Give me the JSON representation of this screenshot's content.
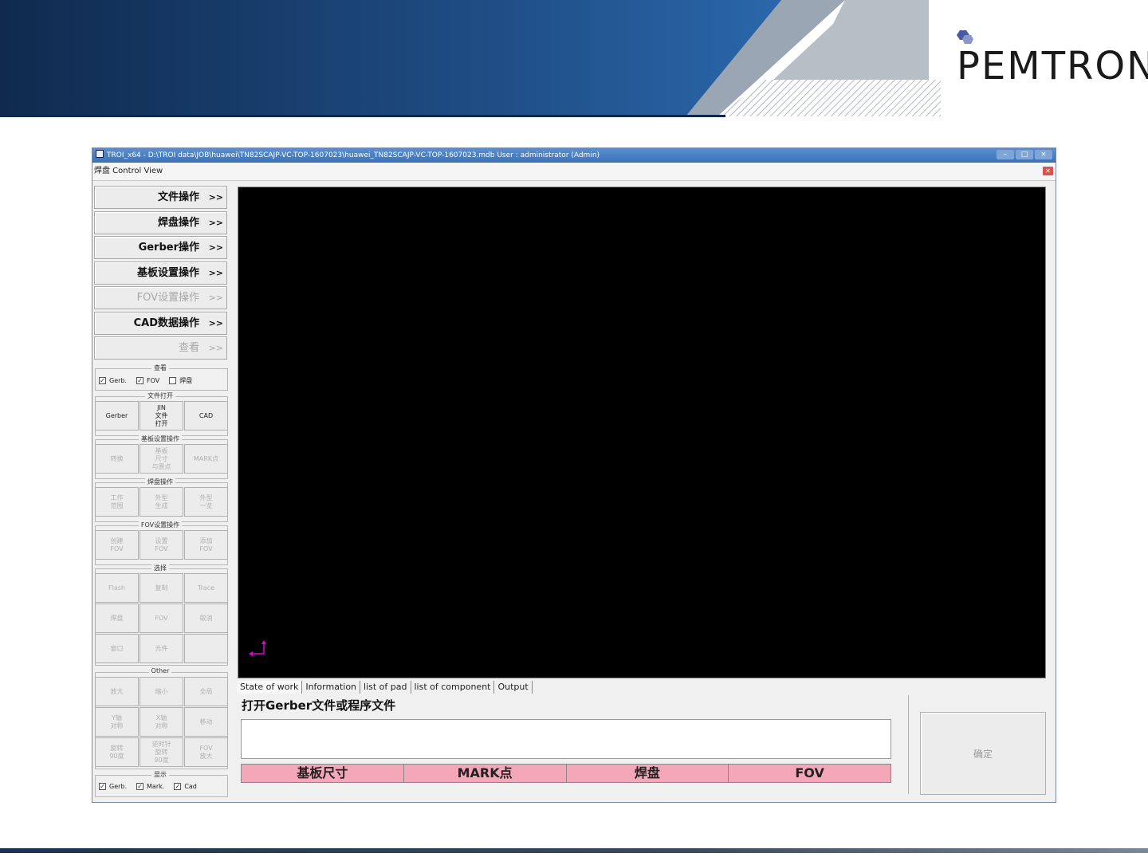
{
  "brand": {
    "logo_text": "PEMTRON"
  },
  "window": {
    "title": "TROI_x64 - D:\\TROI data\\JOB\\huawei\\TN82SCAJP-VC-TOP-1607023\\huawei_TN82SCAJP-VC-TOP-1607023.mdb User : administrator (Admin)",
    "menu_label": "焊盘 Control View"
  },
  "left_panel": {
    "big_buttons": [
      {
        "label": "文件操作",
        "arrow": ">>",
        "enabled": true
      },
      {
        "label": "焊盘操作",
        "arrow": ">>",
        "enabled": true
      },
      {
        "label": "Gerber操作",
        "arrow": ">>",
        "enabled": true
      },
      {
        "label": "基板设置操作",
        "arrow": ">>",
        "enabled": true
      },
      {
        "label": "FOV设置操作",
        "arrow": ">>",
        "enabled": false
      },
      {
        "label": "CAD数据操作",
        "arrow": ">>",
        "enabled": true
      },
      {
        "label": "查看",
        "arrow": ">>",
        "enabled": false
      }
    ],
    "view_group": {
      "title": "查看",
      "checks": [
        {
          "label": "Gerb.",
          "checked": true
        },
        {
          "label": "FOV",
          "checked": true
        },
        {
          "label": "焊盘",
          "checked": false
        }
      ]
    },
    "file_open_group": {
      "title": "文件打开",
      "buttons": [
        "Gerber",
        "JIN\n文件\n打开",
        "CAD"
      ]
    },
    "board_group": {
      "title": "基板设置操作",
      "buttons": [
        "转换",
        "基板\n尺寸\n与原点",
        "MARK点"
      ]
    },
    "pad_group": {
      "title": "焊盘操作",
      "buttons": [
        "工作\n范围",
        "外型\n生成",
        "外型\n一览"
      ]
    },
    "fov_group": {
      "title": "FOV设置操作",
      "buttons": [
        "创建\nFOV",
        "设置\nFOV",
        "添加\nFOV"
      ]
    },
    "select_group": {
      "title": "选择",
      "buttons": [
        "Flash",
        "复制",
        "Trace",
        "焊盘",
        "FOV",
        "取消",
        "窗口",
        "元件",
        ""
      ]
    },
    "other_group": {
      "title": "Other",
      "buttons": [
        "放大",
        "缩小",
        "全局",
        "Y轴\n对称",
        "X轴\n对称",
        "移动",
        "旋转\n90度",
        "逆时针\n旋转\n90度",
        "FOV\n放大"
      ]
    },
    "display_group": {
      "title": "显示",
      "checks": [
        {
          "label": "Gerb.",
          "checked": true
        },
        {
          "label": "Mark.",
          "checked": true
        },
        {
          "label": "Cad",
          "checked": true
        }
      ]
    }
  },
  "tabs": [
    "State of work",
    "Information",
    "list of pad",
    "list of component",
    "Output"
  ],
  "status_message": "打开Gerber文件或程序文件",
  "status_cells": [
    "基板尺寸",
    "MARK点",
    "焊盘",
    "FOV"
  ],
  "confirm_label": "确定",
  "colors": {
    "canvas": "#000000",
    "status_cell": "#f4a7b9",
    "axis": "#e000e0",
    "banner": "#1e3c66"
  }
}
